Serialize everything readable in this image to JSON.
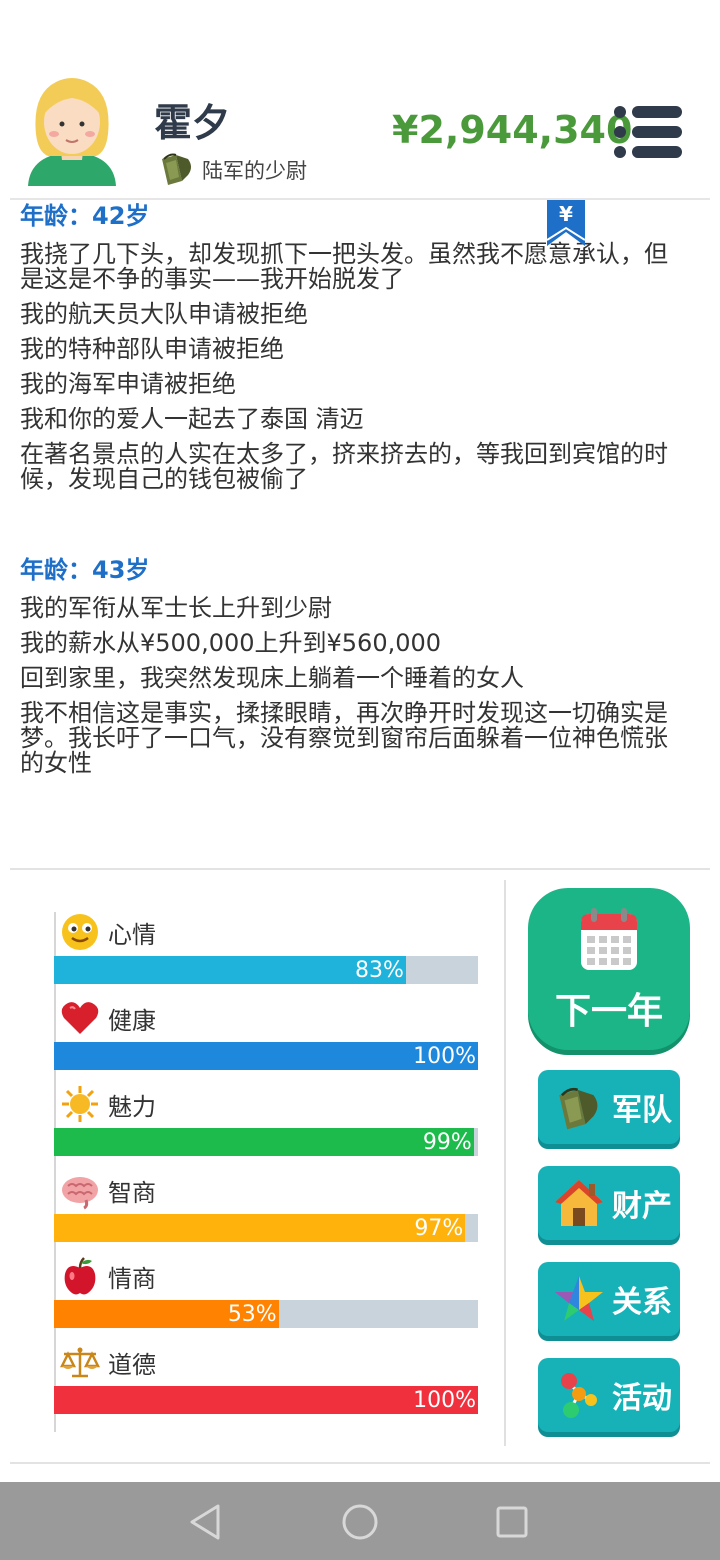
{
  "player": {
    "name": "霍夕",
    "rank": "陆军的少尉",
    "money": "¥2,944,340"
  },
  "log": [
    {
      "age": "年龄：42岁",
      "entries": [
        "我挠了几下头，却发现抓下一把头发。虽然我不愿意承认，但是这是不争的事实——我开始脱发了",
        "我的航天员大队申请被拒绝",
        "我的特种部队申请被拒绝",
        "我的海军申请被拒绝",
        "我和你的爱人一起去了泰国 清迈",
        "在著名景点的人实在太多了，挤来挤去的，等我回到宾馆的时候，发现自己的钱包被偷了"
      ]
    },
    {
      "age": "年龄：43岁",
      "entries": [
        "我的军衔从军士长上升到少尉",
        "我的薪水从¥500,000上升到¥560,000",
        "回到家里，我突然发现床上躺着一个睡着的女人",
        "我不相信这是事实，揉揉眼睛，再次睁开时发现这一切确实是梦。我长吁了一口气，没有察觉到窗帘后面躲着一位神色慌张的女性"
      ]
    }
  ],
  "bookmark_symbol": "¥",
  "stats": [
    {
      "name": "心情",
      "value": 83,
      "label": "83%",
      "color": "#1fb3dc",
      "icon": "smiley-icon"
    },
    {
      "name": "健康",
      "value": 100,
      "label": "100%",
      "color": "#1e88dd",
      "icon": "heart-icon"
    },
    {
      "name": "魅力",
      "value": 99,
      "label": "99%",
      "color": "#1dbb4b",
      "icon": "sun-icon"
    },
    {
      "name": "智商",
      "value": 97,
      "label": "97%",
      "color": "#ffb20c",
      "icon": "brain-icon"
    },
    {
      "name": "情商",
      "value": 53,
      "label": "53%",
      "color": "#ff8200",
      "icon": "apple-icon"
    },
    {
      "name": "道德",
      "value": 100,
      "label": "100%",
      "color": "#f0303d",
      "icon": "scales-icon"
    }
  ],
  "actions": {
    "next_year": "下一年",
    "military": "军队",
    "assets": "财产",
    "relations": "关系",
    "activities": "活动"
  },
  "colors": {
    "money": "#4a9a3c",
    "age_heading": "#1e6fc8",
    "next_year_bg": "#1cb587",
    "side_button_bg": "#16b2b8"
  }
}
